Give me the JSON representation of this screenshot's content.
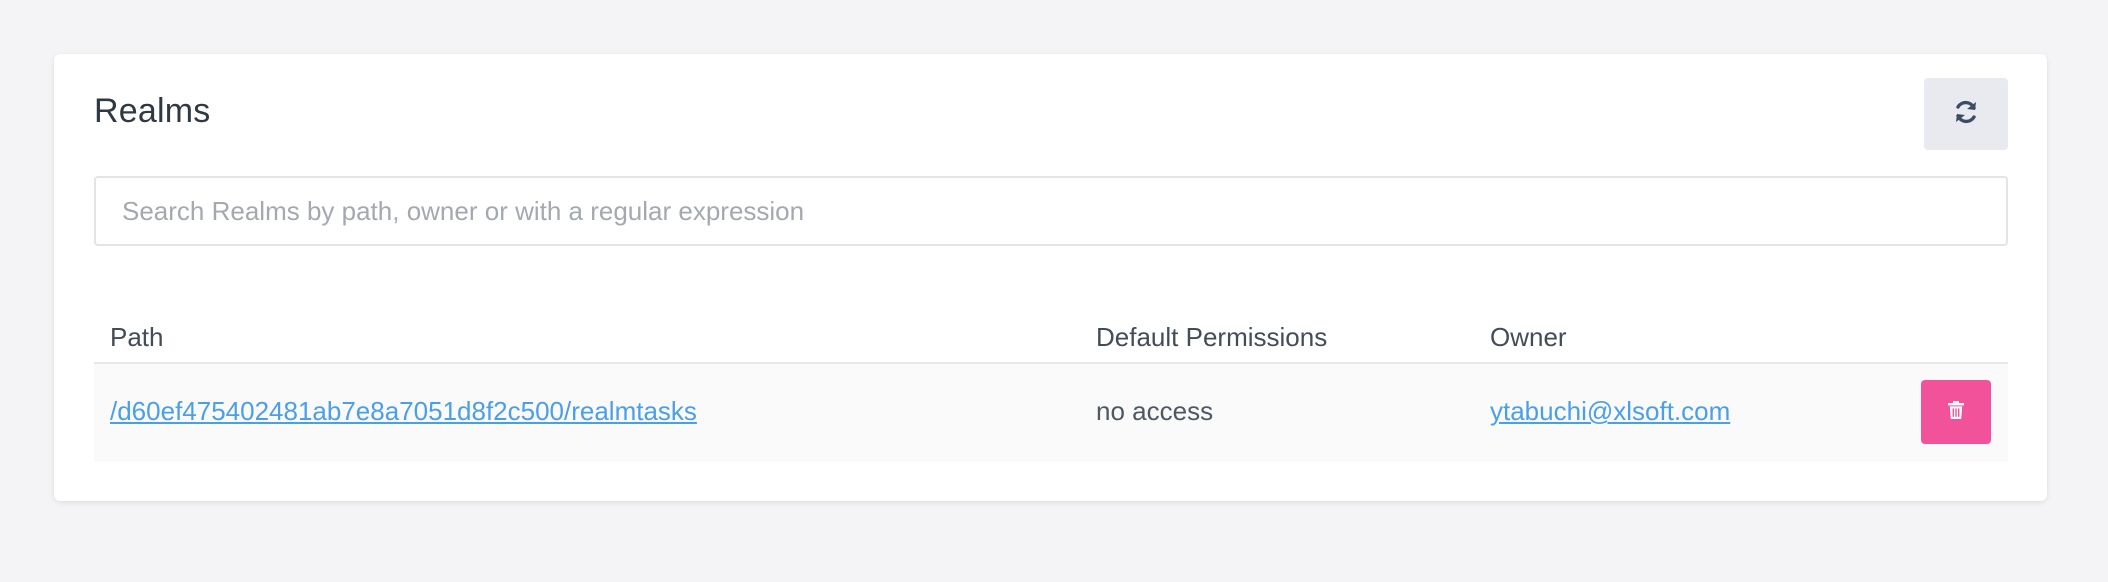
{
  "card": {
    "title": "Realms",
    "refresh_icon": "refresh-icon"
  },
  "search": {
    "placeholder": "Search Realms by path, owner or with a regular expression",
    "value": ""
  },
  "table": {
    "columns": [
      "Path",
      "Default Permissions",
      "Owner"
    ],
    "rows": [
      {
        "path": "/d60ef475402481ab7e8a7051d8f2c500/realmtasks",
        "default_permissions": "no access",
        "owner": "ytabuchi@xlsoft.com",
        "action_icon": "trash-icon"
      }
    ]
  },
  "colors": {
    "background": "#f4f4f6",
    "link": "#4a9fe8",
    "delete_button": "#f2529a",
    "refresh_button": "#e9eaef",
    "refresh_icon": "#3f4a68"
  }
}
